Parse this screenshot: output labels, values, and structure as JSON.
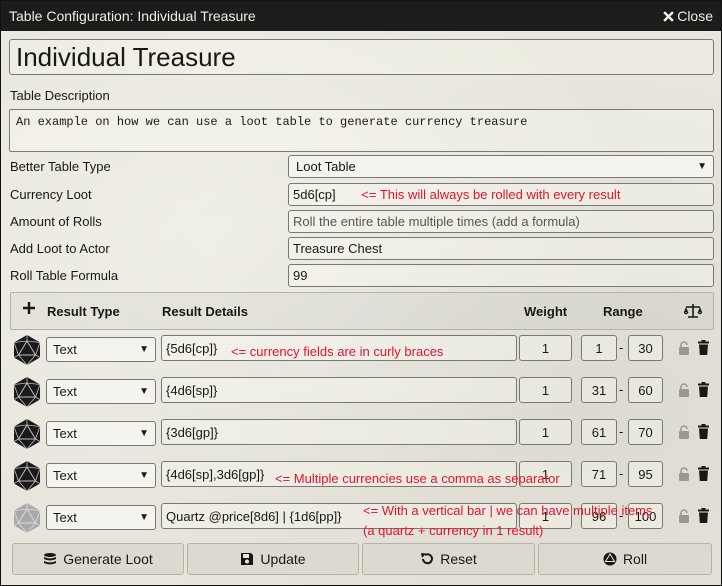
{
  "window": {
    "title": "Table Configuration: Individual Treasure",
    "close_label": "Close"
  },
  "table_name": "Individual Treasure",
  "description": {
    "label": "Table Description",
    "value": "An example on how we can use a loot table to generate currency treasure"
  },
  "fields": {
    "table_type": {
      "label": "Better Table Type",
      "value": "Loot Table"
    },
    "currency_loot": {
      "label": "Currency Loot",
      "value": "5d6[cp]",
      "note": "<= This will always be rolled with every result"
    },
    "amount_of_rolls": {
      "label": "Amount of Rolls",
      "placeholder": "Roll the entire table multiple times (add a formula)"
    },
    "add_loot_to_actor": {
      "label": "Add Loot to Actor",
      "value": "Treasure Chest"
    },
    "roll_table_formula": {
      "label": "Roll Table Formula",
      "value": "99"
    }
  },
  "columns": {
    "result_type": "Result Type",
    "result_details": "Result Details",
    "weight": "Weight",
    "range": "Range"
  },
  "rows": [
    {
      "type": "Text",
      "details": "{5d6[cp]}",
      "weight": "1",
      "range_min": "1",
      "range_max": "30",
      "note": "<= currency fields are in curly braces"
    },
    {
      "type": "Text",
      "details": "{4d6[sp]}",
      "weight": "1",
      "range_min": "31",
      "range_max": "60"
    },
    {
      "type": "Text",
      "details": "{3d6[gp]}",
      "weight": "1",
      "range_min": "61",
      "range_max": "70"
    },
    {
      "type": "Text",
      "details": "{4d6[sp],3d6[gp]}",
      "weight": "1",
      "range_min": "71",
      "range_max": "95",
      "note": "<= Multiple currencies use a comma as separator"
    },
    {
      "type": "Text",
      "details": "Quartz @price[8d6] | {1d6[pp]}",
      "weight": "1",
      "range_min": "96",
      "range_max": "100",
      "note": "<= With a vertical bar | we can have multiple items",
      "note2": "(a quartz + currency in 1 result)"
    }
  ],
  "buttons": {
    "generate_loot": "Generate Loot",
    "update": "Update",
    "reset": "Reset",
    "roll": "Roll"
  },
  "icons": {
    "add": "plus-icon",
    "scale": "balance-scale-icon",
    "lock": "lock-open-icon",
    "trash": "trash-icon",
    "die": "d20-icon"
  },
  "colors": {
    "note": "#e2142d",
    "titlebar": "#1c1c1c",
    "parchment": "#e8e6dc"
  }
}
